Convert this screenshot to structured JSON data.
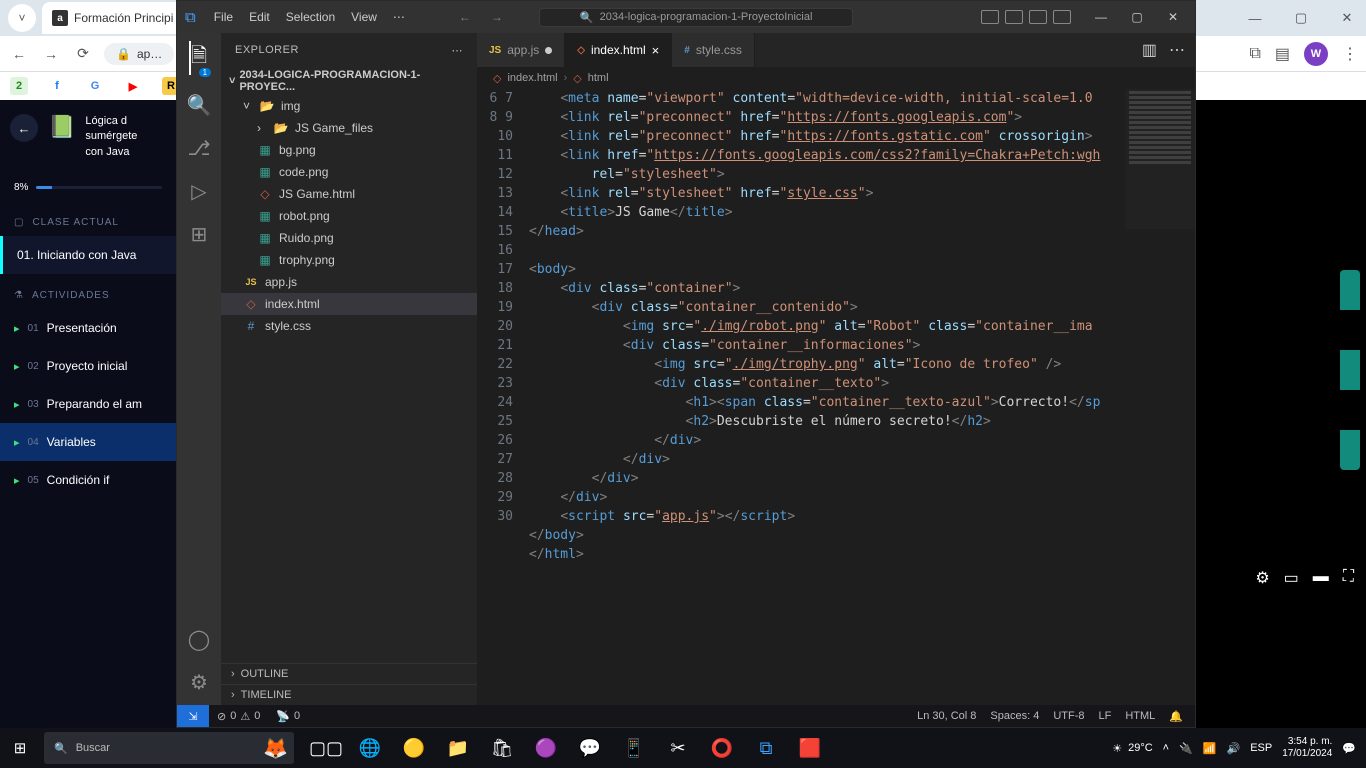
{
  "browser": {
    "tab_title": "Formación Principi",
    "addr": "ap…",
    "window": {
      "min": "—",
      "max": "▢",
      "close": "✕"
    },
    "nav": {
      "back": "←",
      "fwd": "→",
      "reload": "⟳"
    },
    "right": {
      "ext": "⧉",
      "read": "▤",
      "avatar": "W",
      "menu": "⋮"
    },
    "bookmarks": [
      "2",
      "f",
      "G",
      "▶",
      "R"
    ]
  },
  "alura": {
    "back": "←",
    "title": "Lógica d\nsumérgete\ncon Java",
    "progress": "8%",
    "section_current": "CLASE ACTUAL",
    "current": "01. Iniciando con Java",
    "section_acts": "ACTIVIDADES",
    "items": [
      {
        "num": "01",
        "label": "Presentación"
      },
      {
        "num": "02",
        "label": "Proyecto inicial"
      },
      {
        "num": "03",
        "label": "Preparando el am"
      },
      {
        "num": "04",
        "label": "Variables"
      },
      {
        "num": "05",
        "label": "Condición if"
      }
    ]
  },
  "video": {
    "gear": "⚙",
    "pip": "▭",
    "theater": "▬",
    "full": "⛶"
  },
  "vscode": {
    "menus": [
      "File",
      "Edit",
      "Selection",
      "View",
      "⋯"
    ],
    "nav_back": "←",
    "nav_fwd": "→",
    "search_placeholder": "2034-logica-programacion-1-ProyectoInicial",
    "win": {
      "min": "—",
      "max": "▢",
      "close": "✕"
    },
    "explorer": {
      "header": "EXPLORER",
      "root": "2034-LOGICA-PROGRAMACION-1-PROYEC...",
      "tree": [
        {
          "type": "folder",
          "open": true,
          "name": "img",
          "level": 1
        },
        {
          "type": "folder",
          "open": false,
          "name": "JS Game_files",
          "level": 2
        },
        {
          "type": "img",
          "name": "bg.png",
          "level": 2
        },
        {
          "type": "img",
          "name": "code.png",
          "level": 2
        },
        {
          "type": "html",
          "name": "JS Game.html",
          "level": 2
        },
        {
          "type": "img",
          "name": "robot.png",
          "level": 2
        },
        {
          "type": "img",
          "name": "Ruido.png",
          "level": 2
        },
        {
          "type": "img",
          "name": "trophy.png",
          "level": 2
        },
        {
          "type": "js",
          "name": "app.js",
          "level": 1
        },
        {
          "type": "html",
          "name": "index.html",
          "level": 1,
          "selected": true
        },
        {
          "type": "css",
          "name": "style.css",
          "level": 1
        }
      ],
      "outline": "OUTLINE",
      "timeline": "TIMELINE"
    },
    "tabs": [
      {
        "icon": "js",
        "label": "app.js",
        "dirty": true
      },
      {
        "icon": "html",
        "label": "index.html",
        "active": true,
        "close": true
      },
      {
        "icon": "css",
        "label": "style.css"
      }
    ],
    "breadcrumbs": [
      "index.html",
      "html"
    ],
    "code_lines": [
      {
        "n": 6,
        "html": "    <span class='t-br'>&lt;</span><span class='t-tag'>meta</span> <span class='t-attr'>name</span>=<span class='t-str'>\"viewport\"</span> <span class='t-attr'>content</span>=<span class='t-str'>\"width=device-width, initial-scale=1.0</span>"
      },
      {
        "n": 7,
        "html": "    <span class='t-br'>&lt;</span><span class='t-tag'>link</span> <span class='t-attr'>rel</span>=<span class='t-str'>\"preconnect\"</span> <span class='t-attr'>href</span>=<span class='t-str'>\"</span><span class='t-link'>https://fonts.googleapis.com</span><span class='t-str'>\"</span><span class='t-br'>&gt;</span>"
      },
      {
        "n": 8,
        "html": "    <span class='t-br'>&lt;</span><span class='t-tag'>link</span> <span class='t-attr'>rel</span>=<span class='t-str'>\"preconnect\"</span> <span class='t-attr'>href</span>=<span class='t-str'>\"</span><span class='t-link'>https://fonts.gstatic.com</span><span class='t-str'>\"</span> <span class='t-attr'>crossorigin</span><span class='t-br'>&gt;</span>"
      },
      {
        "n": 9,
        "html": "    <span class='t-br'>&lt;</span><span class='t-tag'>link</span> <span class='t-attr'>href</span>=<span class='t-str'>\"</span><span class='t-link'>https://fonts.googleapis.com/css2?family=Chakra+Petch:wgh</span>"
      },
      {
        "n": 10,
        "html": "        <span class='t-attr'>rel</span>=<span class='t-str'>\"stylesheet\"</span><span class='t-br'>&gt;</span>"
      },
      {
        "n": 11,
        "html": "    <span class='t-br'>&lt;</span><span class='t-tag'>link</span> <span class='t-attr'>rel</span>=<span class='t-str'>\"stylesheet\"</span> <span class='t-attr'>href</span>=<span class='t-str'>\"</span><span class='t-link'>style.css</span><span class='t-str'>\"</span><span class='t-br'>&gt;</span>"
      },
      {
        "n": 12,
        "html": "    <span class='t-br'>&lt;</span><span class='t-tag'>title</span><span class='t-br'>&gt;</span><span class='t-txt'>JS Game</span><span class='t-br'>&lt;/</span><span class='t-tag'>title</span><span class='t-br'>&gt;</span>"
      },
      {
        "n": 13,
        "html": "<span class='t-br'>&lt;/</span><span class='t-tag'>head</span><span class='t-br'>&gt;</span>"
      },
      {
        "n": 14,
        "html": " "
      },
      {
        "n": 15,
        "html": "<span class='t-br'>&lt;</span><span class='t-tag'>body</span><span class='t-br'>&gt;</span>"
      },
      {
        "n": 16,
        "html": "    <span class='t-br'>&lt;</span><span class='t-tag'>div</span> <span class='t-attr'>class</span>=<span class='t-str'>\"container\"</span><span class='t-br'>&gt;</span>"
      },
      {
        "n": 17,
        "html": "        <span class='t-br'>&lt;</span><span class='t-tag'>div</span> <span class='t-attr'>class</span>=<span class='t-str'>\"container__contenido\"</span><span class='t-br'>&gt;</span>"
      },
      {
        "n": 18,
        "html": "            <span class='t-br'>&lt;</span><span class='t-tag'>img</span> <span class='t-attr'>src</span>=<span class='t-str'>\"</span><span class='t-link'>./img/robot.png</span><span class='t-str'>\"</span> <span class='t-attr'>alt</span>=<span class='t-str'>\"Robot\"</span> <span class='t-attr'>class</span>=<span class='t-str'>\"container__ima</span>"
      },
      {
        "n": 19,
        "html": "            <span class='t-br'>&lt;</span><span class='t-tag'>div</span> <span class='t-attr'>class</span>=<span class='t-str'>\"container__informaciones\"</span><span class='t-br'>&gt;</span>"
      },
      {
        "n": 20,
        "html": "                <span class='t-br'>&lt;</span><span class='t-tag'>img</span> <span class='t-attr'>src</span>=<span class='t-str'>\"</span><span class='t-link'>./img/trophy.png</span><span class='t-str'>\"</span> <span class='t-attr'>alt</span>=<span class='t-str'>\"Icono de trofeo\"</span> <span class='t-br'>/&gt;</span>"
      },
      {
        "n": 21,
        "html": "                <span class='t-br'>&lt;</span><span class='t-tag'>div</span> <span class='t-attr'>class</span>=<span class='t-str'>\"container__texto\"</span><span class='t-br'>&gt;</span>"
      },
      {
        "n": 22,
        "html": "                    <span class='t-br'>&lt;</span><span class='t-tag'>h1</span><span class='t-br'>&gt;&lt;</span><span class='t-tag'>span</span> <span class='t-attr'>class</span>=<span class='t-str'>\"container__texto-azul\"</span><span class='t-br'>&gt;</span><span class='t-txt'>Correcto!</span><span class='t-br'>&lt;/</span><span class='t-tag'>sp</span>"
      },
      {
        "n": 23,
        "html": "                    <span class='t-br'>&lt;</span><span class='t-tag'>h2</span><span class='t-br'>&gt;</span><span class='t-txt'>Descubriste el número secreto!</span><span class='t-br'>&lt;/</span><span class='t-tag'>h2</span><span class='t-br'>&gt;</span>"
      },
      {
        "n": 24,
        "html": "                <span class='t-br'>&lt;/</span><span class='t-tag'>div</span><span class='t-br'>&gt;</span>"
      },
      {
        "n": 25,
        "html": "            <span class='t-br'>&lt;/</span><span class='t-tag'>div</span><span class='t-br'>&gt;</span>"
      },
      {
        "n": 26,
        "html": "        <span class='t-br'>&lt;/</span><span class='t-tag'>div</span><span class='t-br'>&gt;</span>"
      },
      {
        "n": 27,
        "html": "    <span class='t-br'>&lt;/</span><span class='t-tag'>div</span><span class='t-br'>&gt;</span>"
      },
      {
        "n": 28,
        "html": "    <span class='t-br'>&lt;</span><span class='t-tag'>script</span> <span class='t-attr'>src</span>=<span class='t-str'>\"</span><span class='t-link'>app.js</span><span class='t-str'>\"</span><span class='t-br'>&gt;&lt;/</span><span class='t-tag'>script</span><span class='t-br'>&gt;</span>"
      },
      {
        "n": 29,
        "html": "<span class='t-br'>&lt;/</span><span class='t-tag'>body</span><span class='t-br'>&gt;</span>"
      },
      {
        "n": 30,
        "html": "<span class='t-br'>&lt;/</span><span class='t-tag'>html</span><span class='t-br'>&gt;</span>"
      }
    ],
    "status": {
      "errors": "0",
      "warnings": "0",
      "ports": "0",
      "ln_col": "Ln 30, Col 8",
      "spaces": "Spaces: 4",
      "enc": "UTF-8",
      "eol": "LF",
      "lang": "HTML",
      "bell": "🔔"
    }
  },
  "taskbar": {
    "search_placeholder": "Buscar",
    "weather": "29°C",
    "lang": "ESP",
    "time": "3:54 p. m.",
    "date": "17/01/2024",
    "icons": {
      "wifi": "📶",
      "vol": "🔊",
      "up": "˄",
      "batt": "🔌",
      "notif": "💬"
    }
  }
}
